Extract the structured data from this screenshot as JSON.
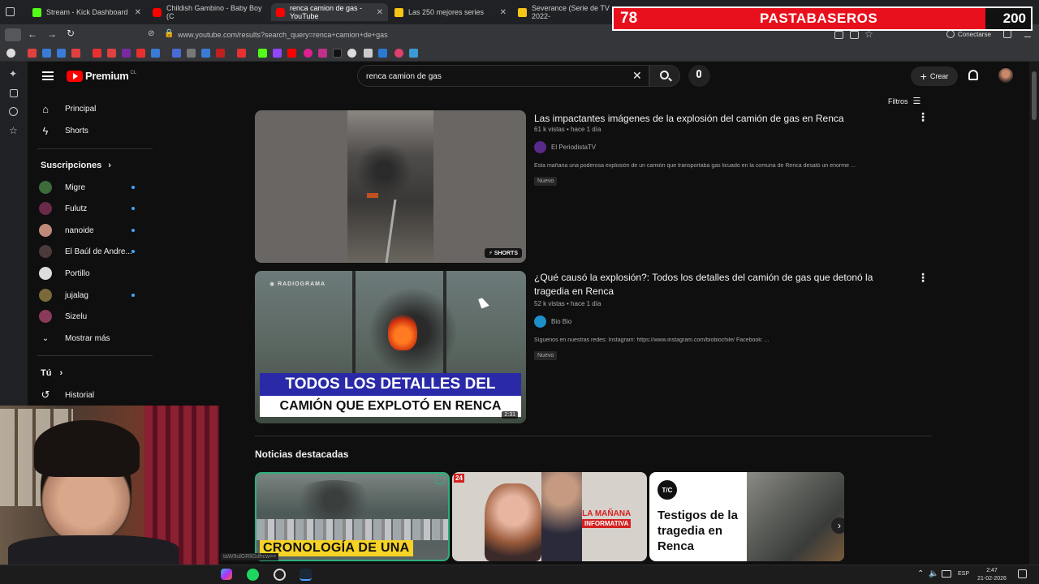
{
  "browser": {
    "tabs": [
      {
        "label": "Stream - Kick Dashboard",
        "color": "#53fc18",
        "active": false
      },
      {
        "label": "Childish Gambino - Baby Boy (C",
        "color": "#ff0000",
        "active": false
      },
      {
        "label": "renca camion de gas - YouTube",
        "color": "#ff0000",
        "active": true
      },
      {
        "label": "Las 250 mejores series",
        "color": "#f5c518",
        "active": false
      },
      {
        "label": "Severance (Serie de TV 2022-",
        "color": "#f5c518",
        "active": false
      }
    ],
    "url": "www.youtube.com/results?search_query=renca+camion+de+gas",
    "connect_label": "Conectarse",
    "add_tab": "+"
  },
  "overlay": {
    "left_count": "78",
    "title": "PASTABASEROS",
    "right_count": "200",
    "status_url": "taW9ulGRllGdhcw=="
  },
  "youtube": {
    "logo": "Premium",
    "logo_region": "CL",
    "search_value": "renca camion de gas",
    "create_label": "Crear",
    "filters_label": "Filtros",
    "nav": [
      {
        "label": "Principal",
        "icon": "home-icon"
      },
      {
        "label": "Shorts",
        "icon": "shorts-icon"
      }
    ],
    "subscriptions_label": "Suscripciones",
    "subscriptions": [
      {
        "name": "Migre",
        "color": "#3c6b3c",
        "dot": true
      },
      {
        "name": "Fulutz",
        "color": "#6a2a4a",
        "dot": true
      },
      {
        "name": "nanoide",
        "color": "#c08a7a",
        "dot": true
      },
      {
        "name": "El Baúl de Andre...",
        "color": "#4a3a3a",
        "dot": true
      },
      {
        "name": "Portillo",
        "color": "#dddddd",
        "dot": false
      },
      {
        "name": "jujalag",
        "color": "#7a6a3a",
        "dot": true
      },
      {
        "name": "Sizelu",
        "color": "#8a3a5a",
        "dot": false
      }
    ],
    "show_more_label": "Mostrar más",
    "you_label": "Tú",
    "history_label": "Historial",
    "results": [
      {
        "title": "Las impactantes imágenes de la explosión del camión de gas en Renca",
        "meta": "61 k vistas • hace 1 día",
        "channel": "El PeriodistaTV",
        "desc": "Esta mañana una poderosa explosión de un camión que transportaba gas licuado en la comuna de Renca desató un enorme ...",
        "badge": "Nuevo",
        "thumb_label": "SHORTS"
      },
      {
        "title": "¿Qué causó la explosión?: Todos los detalles del camión de gas que detonó la tragedia en Renca",
        "meta": "52 k vistas • hace 1 día",
        "channel": "Bio Bio",
        "desc": "Síguenos en nuestras redes: Instagram: https://www.instagram.com/biobiochile/ Facebook: ...",
        "badge": "Nuevo",
        "thumb_brand": "RADIOGRAMA",
        "thumb_caption_1": "TODOS LOS DETALLES DEL",
        "thumb_caption_2": "CAMIÓN QUE EXPLOTÓ EN RENCA",
        "thumb_duration": "2:31"
      }
    ],
    "news_heading": "Noticias destacadas",
    "news": [
      {
        "caption": "CRONOLOGÍA DE UNA"
      },
      {
        "brand_1": "LA MAÑANA",
        "brand_2": "INFORMATIVA",
        "badge": "24"
      },
      {
        "logo": "T/C",
        "caption": "Testigos de la tragedia en Renca"
      }
    ]
  },
  "taskbar": {
    "lang": "ESP",
    "time": "2:47",
    "date": "21-02-2026"
  }
}
